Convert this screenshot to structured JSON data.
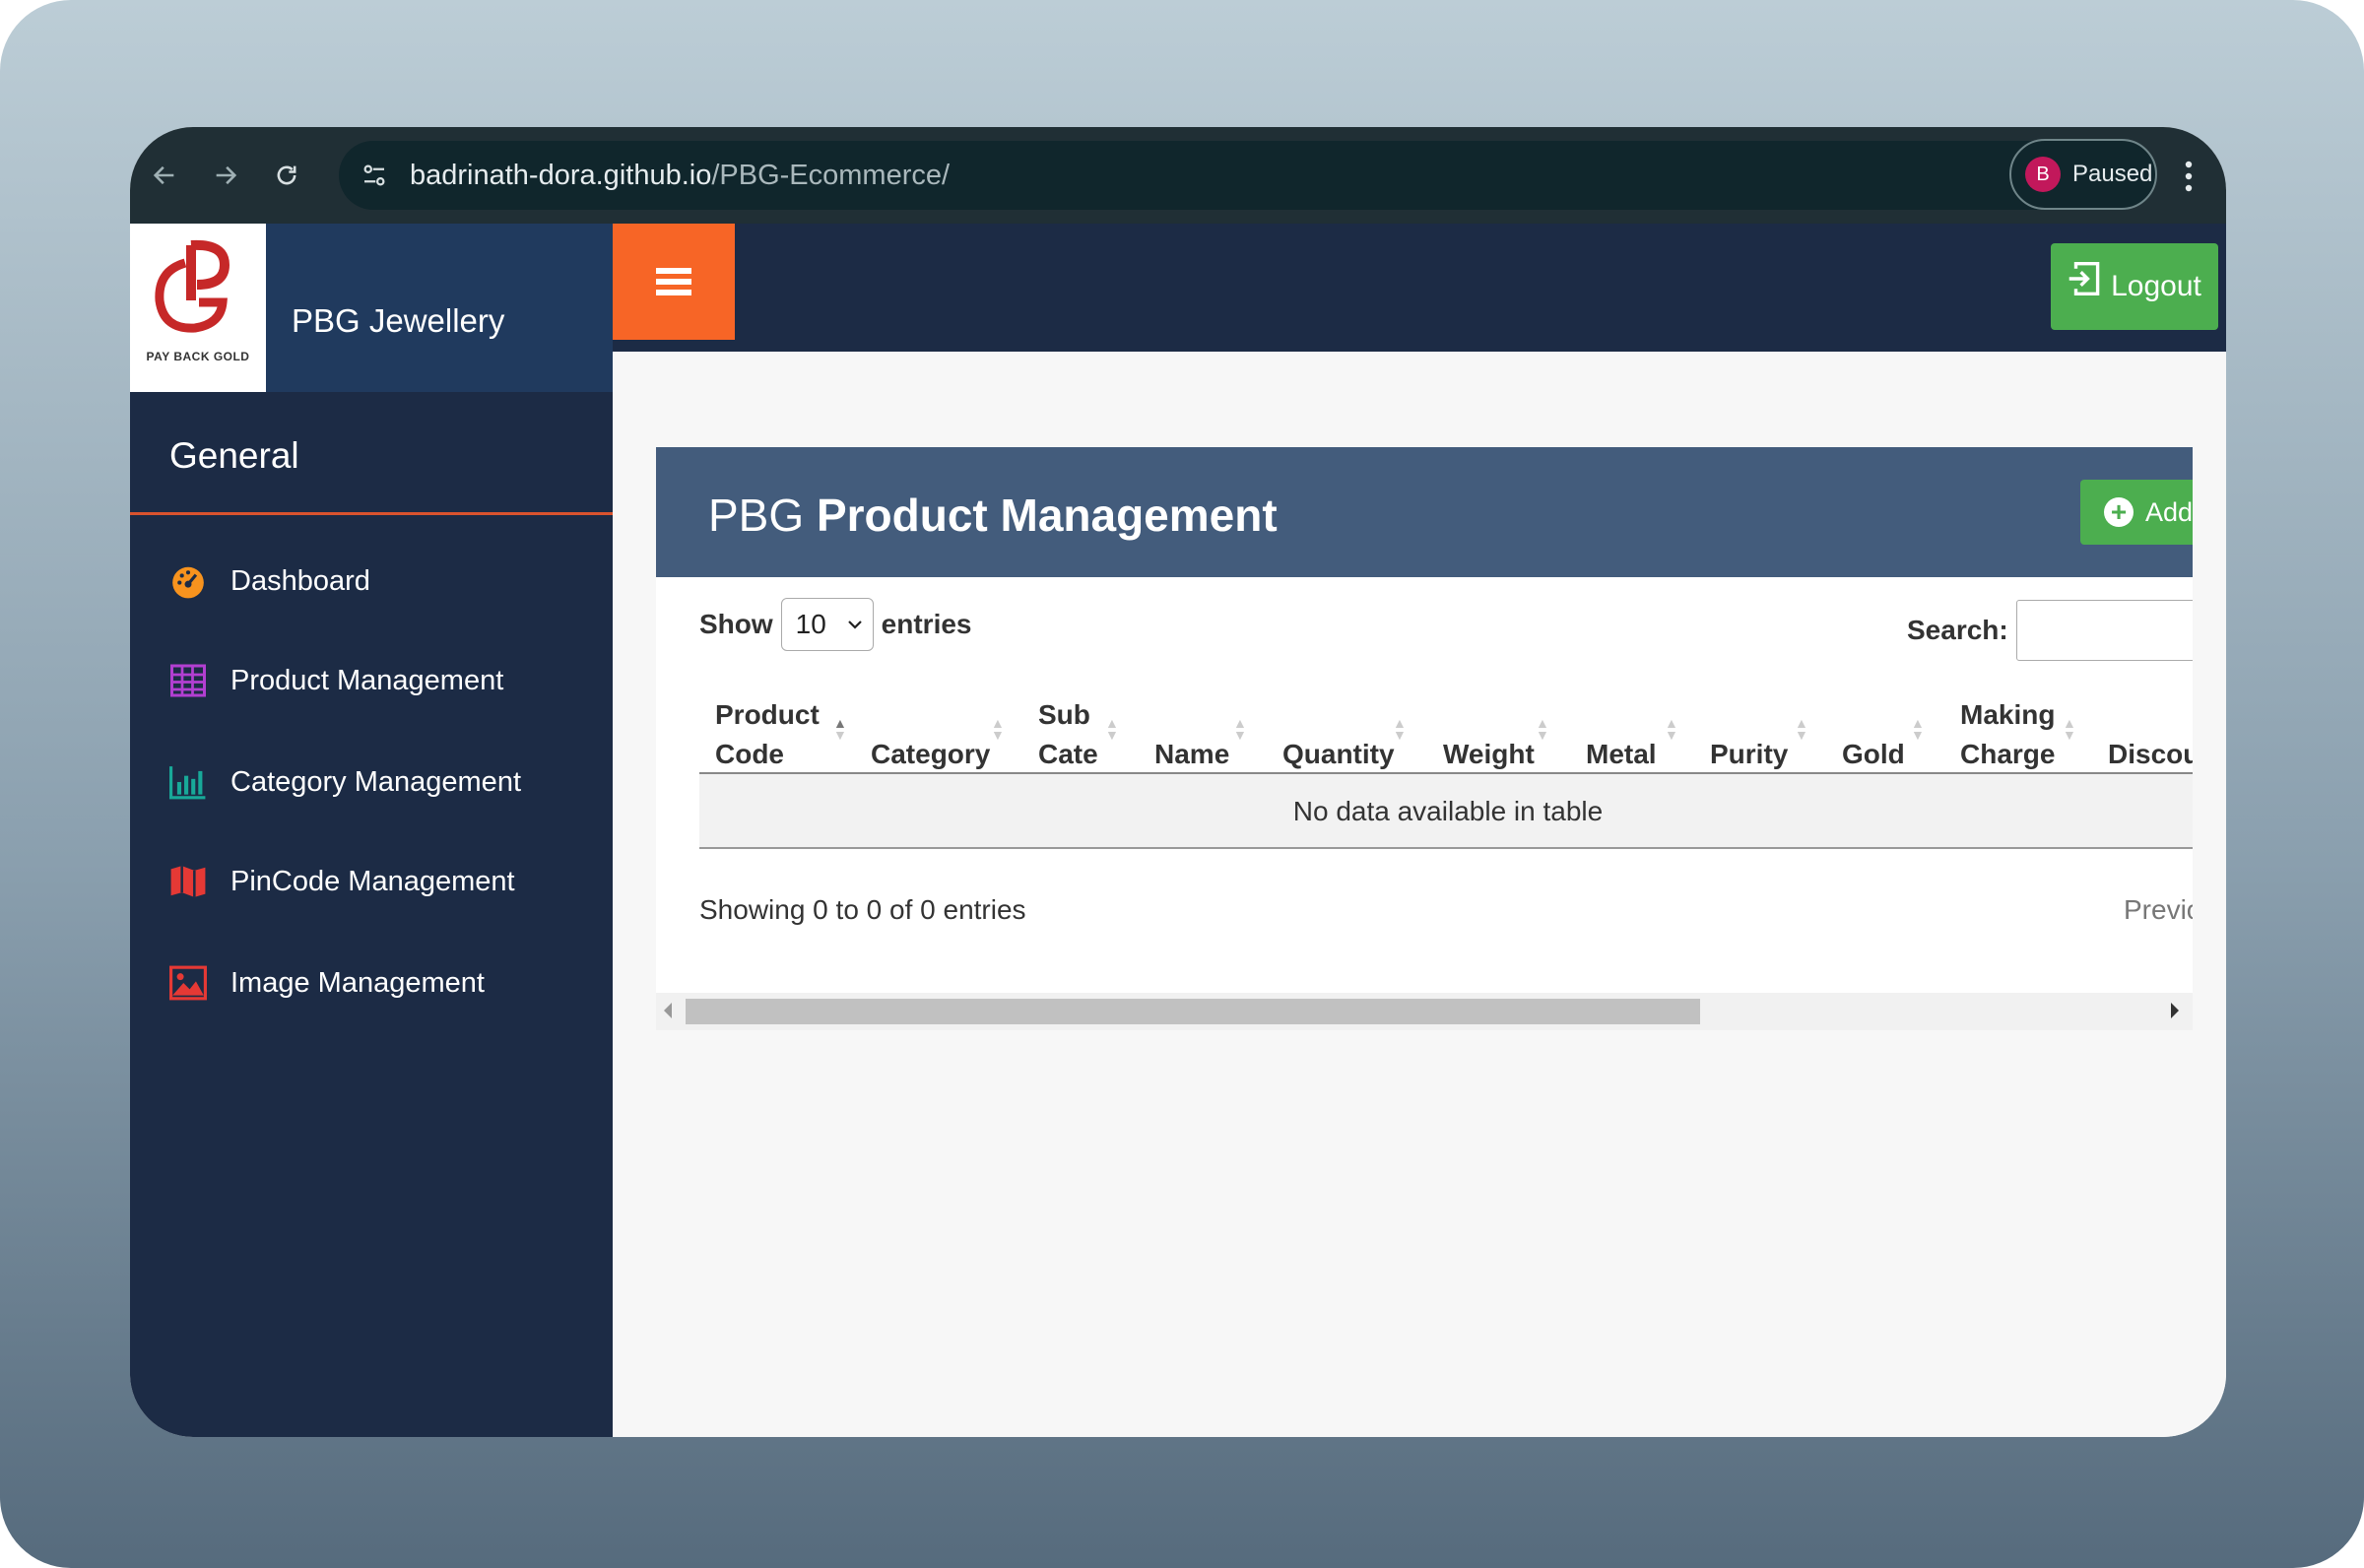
{
  "browser": {
    "url_host": "badrinath-dora.github.io",
    "url_path": "/PBG-Ecommerce/",
    "profile_initial": "B",
    "profile_status": "Paused"
  },
  "brand": {
    "logo_text": "PAY BACK GOLD",
    "name": "PBG Jewellery"
  },
  "sidebar": {
    "section": "General",
    "items": [
      {
        "label": "Dashboard",
        "icon": "dashboard-icon"
      },
      {
        "label": "Product Management",
        "icon": "table-grid-icon"
      },
      {
        "label": "Category Management",
        "icon": "bar-chart-icon"
      },
      {
        "label": "PinCode Management",
        "icon": "map-icon"
      },
      {
        "label": "Image Management",
        "icon": "image-icon"
      }
    ]
  },
  "topbar": {
    "logout_label": "Logout"
  },
  "page": {
    "title_prefix": "PBG",
    "title_main": "Product Management",
    "add_label": "Add"
  },
  "table_controls": {
    "show_label": "Show",
    "entries_value": "10",
    "entries_label": "entries",
    "search_label": "Search:"
  },
  "table": {
    "columns": [
      {
        "line1": "Product",
        "line2": "Code"
      },
      {
        "line1": "",
        "line2": "Category"
      },
      {
        "line1": "Sub",
        "line2": "Cate"
      },
      {
        "line1": "",
        "line2": "Name"
      },
      {
        "line1": "",
        "line2": "Quantity"
      },
      {
        "line1": "",
        "line2": "Weight"
      },
      {
        "line1": "",
        "line2": "Metal"
      },
      {
        "line1": "",
        "line2": "Purity"
      },
      {
        "line1": "",
        "line2": "Gold"
      },
      {
        "line1": "Making",
        "line2": "Charge"
      },
      {
        "line1": "",
        "line2": "Discou"
      }
    ],
    "empty_message": "No data available in table",
    "info": "Showing 0 to 0 of 0 entries",
    "prev_label": "Previo"
  },
  "colors": {
    "sidebar_bg": "#1c2b45",
    "brand_bg": "#203a5e",
    "accent_orange": "#f76526",
    "accent_green": "#4cae4f",
    "card_header": "#435c7c"
  }
}
